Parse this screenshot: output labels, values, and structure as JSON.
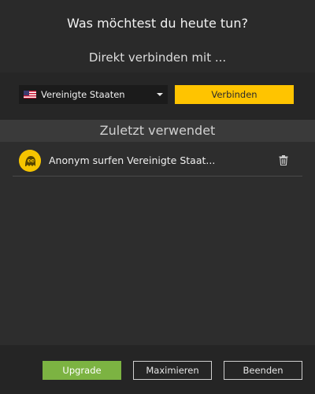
{
  "header": {
    "title": "Was möchtest du heute tun?",
    "subtitle": "Direkt verbinden mit ..."
  },
  "connect": {
    "country": "Vereinigte Staaten",
    "flag_icon": "us-flag-icon",
    "connect_label": "Verbinden",
    "accent_color": "#ffc400"
  },
  "recent": {
    "header": "Zuletzt verwendet",
    "items": [
      {
        "label": "Anonym surfen Vereinigte Staat...",
        "icon": "ghost-avatar-icon",
        "action_icon": "trash-icon"
      }
    ]
  },
  "footer": {
    "upgrade_label": "Upgrade",
    "maximize_label": "Maximieren",
    "quit_label": "Beenden",
    "upgrade_color": "#7cb342"
  }
}
